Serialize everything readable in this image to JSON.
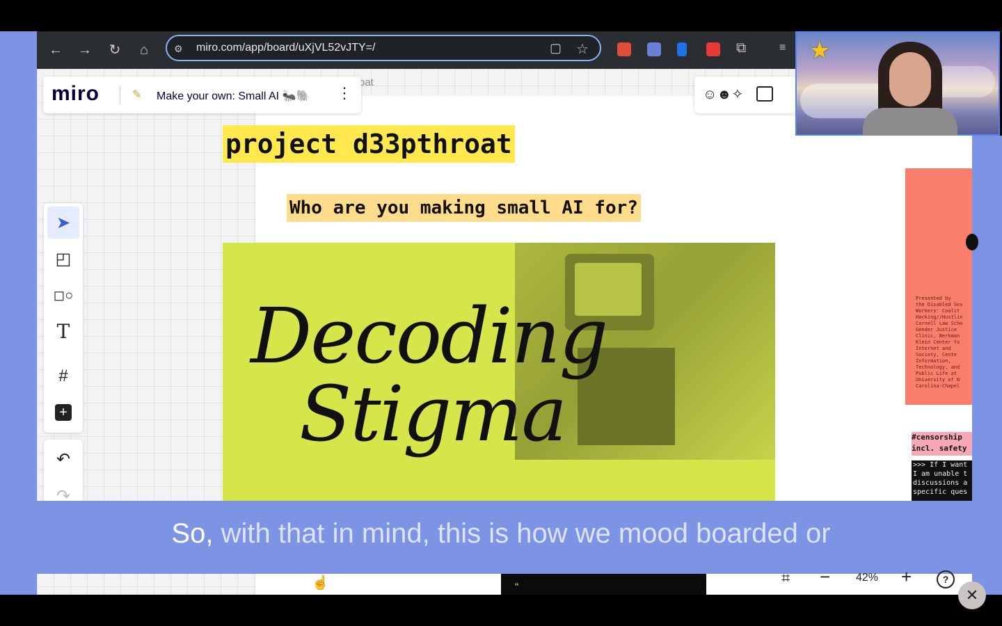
{
  "browser": {
    "url": "miro.com/app/board/uXjVL52vJTY=/"
  },
  "miro": {
    "logo": "miro",
    "board_title": "Make your own: Small AI 🐜🐘",
    "frame_label": "oat",
    "zoom": "42%"
  },
  "board": {
    "project_title": "project d33pthroat",
    "question": "Who are you making small AI for?",
    "poster_title_line1": "Decoding",
    "poster_title_line2": "Stigma",
    "salmon_card_text": "Presented by\nthe Disabled Sex\nWorkers' Coalit\nHacking//Hustlin\nCornell Law Scho\nGender Justice\nClinic, Berkman\nKlein Center fo\nInternet and\nSociety, Cente\nInformation,\nTechnology, and\nPublic Life at\nUniversity of N\nCarolina-Chapel",
    "censorship_tag": "#censorship\nincl. safety",
    "dark_note": ">>> If I want\nI am unable t\ndiscussions a\nspecific ques",
    "lower_quote": "“"
  },
  "caption": {
    "spoken": "So,",
    "upcoming": " with that in mind, this is how we mood boarded or"
  },
  "colors": {
    "accent_blue": "#7d94e4",
    "title_highlight": "#ffe94f",
    "question_highlight": "#ffdb8c",
    "poster_yellow": "#d6e64a",
    "salmon": "#f87f6c",
    "pink_tag": "#f6a9b4"
  },
  "icons": {
    "toolbar": [
      "cursor-icon",
      "sticky-note-icon",
      "shapes-icon",
      "text-icon",
      "frame-icon",
      "plus-icon",
      "undo-icon",
      "redo-icon"
    ],
    "browser": [
      "back-icon",
      "forward-icon",
      "reload-icon",
      "home-icon",
      "site-settings-icon",
      "clipboard-icon",
      "bookmark-star-icon",
      "extension-icon"
    ]
  }
}
